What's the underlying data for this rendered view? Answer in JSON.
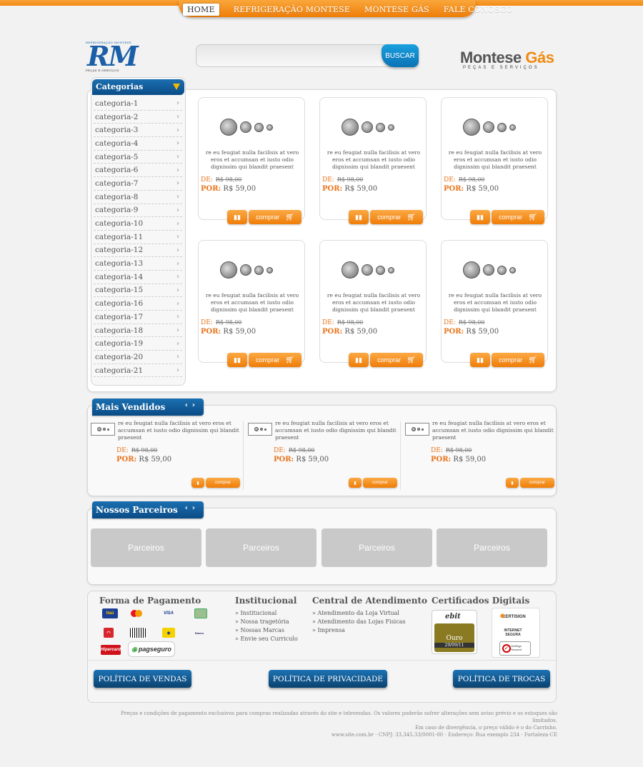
{
  "nav": {
    "items": [
      "HOME",
      "REFRIGERAÇÃO MONTESE",
      "MONTESE GÁS",
      "FALE CONOSCO"
    ]
  },
  "logo_rm": {
    "text": "RM",
    "tagline_top": "REFRIGERAÇÃO MONTESE",
    "tagline_bottom": "PEÇAS E SERVIÇOS"
  },
  "search": {
    "value": "",
    "button": "BUSCAR"
  },
  "logo_mg": {
    "text_a": "Montese ",
    "text_b": "Gás",
    "tagline": "PEÇAS E SERVIÇOS"
  },
  "categories": {
    "title": "Categorias",
    "items": [
      "categoria-1",
      "categoria-2",
      "categoria-3",
      "categoria-4",
      "categoria-5",
      "categoria-6",
      "categoria-7",
      "categoria-8",
      "categoria-9",
      "categoria-10",
      "categoria-11",
      "categoria-12",
      "categoria-13",
      "categoria-14",
      "categoria-15",
      "categoria-16",
      "categoria-17",
      "categoria-18",
      "categoria-19",
      "categoria-20",
      "categoria-21"
    ]
  },
  "product": {
    "desc": "re eu feugiat nulla facilisis at vero eros et accumsan et iusto odio dignissim qui blandit praesent",
    "de_label": "DE:",
    "de_price": "R$ 98,00",
    "por_label": "POR:",
    "por_price": "R$ 59,00",
    "buy_label": "comprar"
  },
  "mais_vendidos": {
    "title": "Mais Vendidos"
  },
  "parceiros": {
    "title": "Nossos Parceiros",
    "items": [
      "Parceiros",
      "Parceiros",
      "Parceiros",
      "Parceiros"
    ]
  },
  "footer": {
    "pagamento": {
      "title": "Forma de Pagamento",
      "brands": [
        "Itaú",
        "Mastercard",
        "VISA",
        "Boleto",
        "Bradesco",
        "Código",
        "Banco do Brasil",
        "Diners Club",
        "Hipercard",
        "pagseguro"
      ]
    },
    "institucional": {
      "title": "Institucional",
      "links": [
        "» Institucional",
        "» Nossa tragetória",
        "» Nossas Marcas",
        "» Envie seu Curriculo"
      ]
    },
    "atendimento": {
      "title": "Central de Atendimento",
      "links": [
        "» Atendimento da Loja Virtual",
        "» Atendimento das Lojas Fisicas",
        "» Imprensa"
      ]
    },
    "certificados": {
      "title": "Certificados Digitais",
      "ebit": "ebit",
      "ebit_level": "Ouro",
      "ebit_date": "29/09/11",
      "certisign": "CERTISIGN",
      "internet_segura": "INTERNET SEGURA",
      "verisign": "VeriSign Secured"
    },
    "buttons": [
      "POLÍTICA DE VENDAS",
      "POLÍTICA DE PRIVACIDADE",
      "POLÍTICA DE TROCAS"
    ]
  },
  "copyright": {
    "line1": "Preços e condições de pagamento exclusivos para compras realizadas através do site e televendas. Os valores poderão sofrer alterações sem aviso prévio e os estoques são limitados.",
    "line2": "Em caso de divergência, o preço válido é o do Carrinho.",
    "line3": "www.site.com.br - CNPJ: 33.345.33/0001-00 - Endereço: Rua exemplo 234 - Fortaleza-CE"
  }
}
